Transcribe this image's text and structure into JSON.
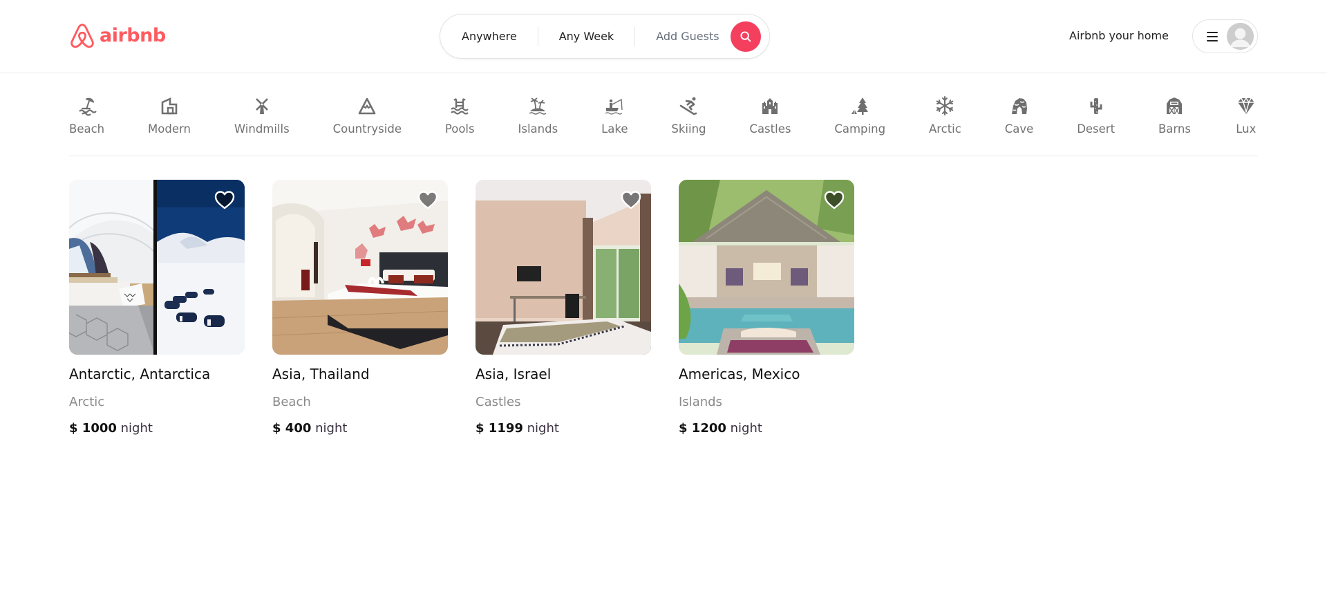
{
  "brand": {
    "name": "airbnb",
    "color": "#FF5A5F",
    "accent": "#F43F5E"
  },
  "search": {
    "location": "Anywhere",
    "dates": "Any Week",
    "guests_placeholder": "Add Guests",
    "button_icon": "search-icon"
  },
  "header": {
    "host_link": "Airbnb your home",
    "menu_icon": "hamburger-icon",
    "avatar_icon": "user-avatar-icon"
  },
  "categories": [
    {
      "label": "Beach",
      "icon": "beach-umbrella-icon"
    },
    {
      "label": "Modern",
      "icon": "modern-house-icon"
    },
    {
      "label": "Windmills",
      "icon": "windmill-icon"
    },
    {
      "label": "Countryside",
      "icon": "mountain-icon"
    },
    {
      "label": "Pools",
      "icon": "pool-ladder-icon"
    },
    {
      "label": "Islands",
      "icon": "palm-island-icon"
    },
    {
      "label": "Lake",
      "icon": "fishing-boat-icon"
    },
    {
      "label": "Skiing",
      "icon": "skier-icon"
    },
    {
      "label": "Castles",
      "icon": "castle-icon"
    },
    {
      "label": "Camping",
      "icon": "tent-tree-icon"
    },
    {
      "label": "Arctic",
      "icon": "snowflake-icon"
    },
    {
      "label": "Cave",
      "icon": "cave-icon"
    },
    {
      "label": "Desert",
      "icon": "cactus-icon"
    },
    {
      "label": "Barns",
      "icon": "barn-icon"
    },
    {
      "label": "Lux",
      "icon": "diamond-icon"
    }
  ],
  "listings": [
    {
      "title": "Antarctic, Antarctica",
      "category": "Arctic",
      "price": "$ 1000",
      "unit": "night",
      "image": "dome-tent-snow-camp"
    },
    {
      "title": "Asia, Thailand",
      "category": "Beach",
      "price": "$ 400",
      "unit": "night",
      "image": "hotel-bedroom-red-mural"
    },
    {
      "title": "Asia, Israel",
      "category": "Castles",
      "price": "$ 1199",
      "unit": "night",
      "image": "bedroom-with-window"
    },
    {
      "title": "Americas, Mexico",
      "category": "Islands",
      "price": "$ 1200",
      "unit": "night",
      "image": "thatched-villa-pool"
    }
  ]
}
